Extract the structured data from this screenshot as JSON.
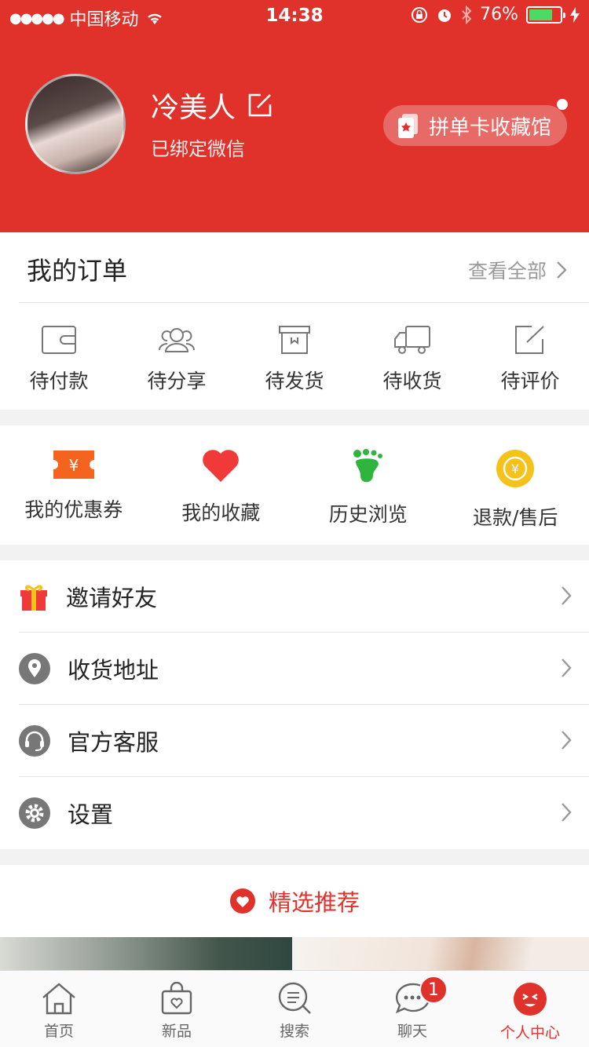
{
  "status_bar": {
    "signal": "●●●●●",
    "carrier": "中国移动",
    "time": "14:38",
    "battery": "76%",
    "battery_level": 0.76
  },
  "profile": {
    "name": "冷美人",
    "subtitle": "已绑定微信",
    "collection_button": "拼单卡收藏馆"
  },
  "orders": {
    "title": "我的订单",
    "view_all": "查看全部",
    "items": [
      {
        "label": "待付款",
        "icon": "wallet-icon"
      },
      {
        "label": "待分享",
        "icon": "users-icon"
      },
      {
        "label": "待发货",
        "icon": "box-icon"
      },
      {
        "label": "待收货",
        "icon": "truck-icon"
      },
      {
        "label": "待评价",
        "icon": "edit-icon"
      }
    ]
  },
  "quick": [
    {
      "label": "我的优惠券",
      "icon": "coupon-icon",
      "color": "#f5641e"
    },
    {
      "label": "我的收藏",
      "icon": "heart-icon",
      "color": "#f03a3a"
    },
    {
      "label": "历史浏览",
      "icon": "footprint-icon",
      "color": "#2fb53e"
    },
    {
      "label": "退款/售后",
      "icon": "refund-icon",
      "color": "#f5c21a"
    }
  ],
  "menu": [
    {
      "label": "邀请好友",
      "icon": "gift-icon"
    },
    {
      "label": "收货地址",
      "icon": "location-icon"
    },
    {
      "label": "官方客服",
      "icon": "headset-icon"
    },
    {
      "label": "设置",
      "icon": "gear-icon"
    }
  ],
  "recommend": {
    "title": "精选推荐"
  },
  "tabs": [
    {
      "label": "首页",
      "icon": "home-icon"
    },
    {
      "label": "新品",
      "icon": "bag-icon"
    },
    {
      "label": "搜索",
      "icon": "search-icon"
    },
    {
      "label": "聊天",
      "icon": "chat-icon",
      "badge": "1"
    },
    {
      "label": "个人中心",
      "icon": "profile-icon",
      "active": true
    }
  ],
  "colors": {
    "brand": "#e0312b",
    "text": "#222222",
    "muted": "#999999"
  }
}
